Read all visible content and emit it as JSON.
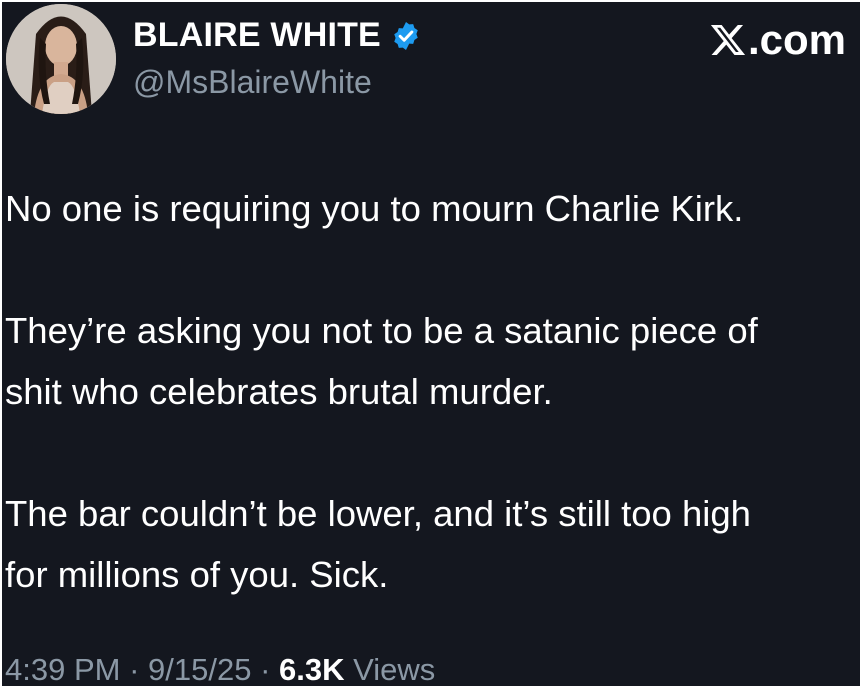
{
  "author": {
    "display_name": "BLAIRE WHITE",
    "handle": "@MsBlaireWhite",
    "verified": true,
    "avatar_icon": "profile-photo"
  },
  "brand": {
    "label": ".com",
    "logo_icon": "x-logo-icon"
  },
  "tweet": {
    "paragraphs": [
      [
        "No one is requiring you to mourn Charlie Kirk."
      ],
      [
        "They’re asking you not to be a satanic piece of",
        "shit who celebrates brutal murder."
      ],
      [
        "The bar couldn’t be lower, and it’s still too high",
        "for millions of you. Sick."
      ]
    ]
  },
  "meta": {
    "time": "4:39 PM",
    "separator": "·",
    "date": "9/15/25",
    "views_count": "6.3K",
    "views_label": "Views"
  },
  "colors": {
    "background": "#14171f",
    "text": "#ffffff",
    "secondary_text": "#8b98a5",
    "verified_badge": "#1d9bf0"
  }
}
